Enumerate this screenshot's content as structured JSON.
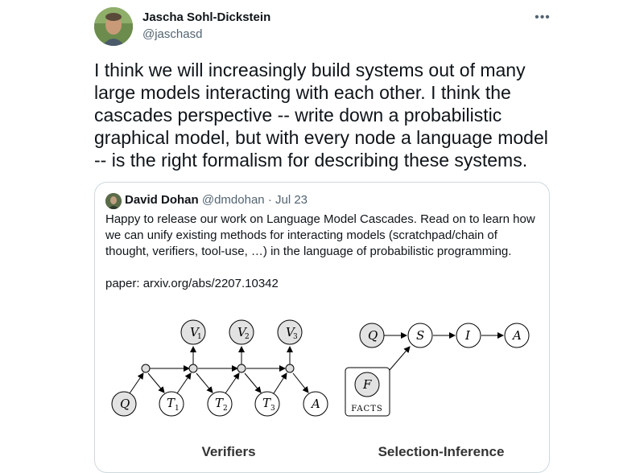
{
  "author": {
    "name": "Jascha Sohl-Dickstein",
    "handle": "@jaschasd"
  },
  "more_icon": "more-horizontal-icon",
  "tweet_text": "I think we will increasingly build systems out of many large models interacting with each other. I think the cascades perspective -- write down a probabilistic graphical model, but with every node a language model -- is the right formalism for describing these systems.",
  "quoted": {
    "name": "David Dohan",
    "handle": "@dmdohan",
    "sep": "·",
    "date": "Jul 23",
    "text": "Happy to release our work on Language Model Cascades. Read on to learn how we can unify existing methods for interacting models (scratchpad/chain of thought, verifiers, tool-use, …) in the language of probabilistic programming.",
    "link_text": "paper: arxiv.org/abs/2207.10342"
  },
  "figure": {
    "verifiers": {
      "title": "Verifiers",
      "nodes": [
        "Q",
        "T",
        "T",
        "T",
        "A",
        "V",
        "V",
        "V"
      ],
      "subscripts": [
        "1",
        "2",
        "3"
      ]
    },
    "selection": {
      "title": "Selection-Inference",
      "nodes": [
        "Q",
        "S",
        "I",
        "A",
        "F"
      ],
      "facts_label": "FACTS"
    }
  }
}
